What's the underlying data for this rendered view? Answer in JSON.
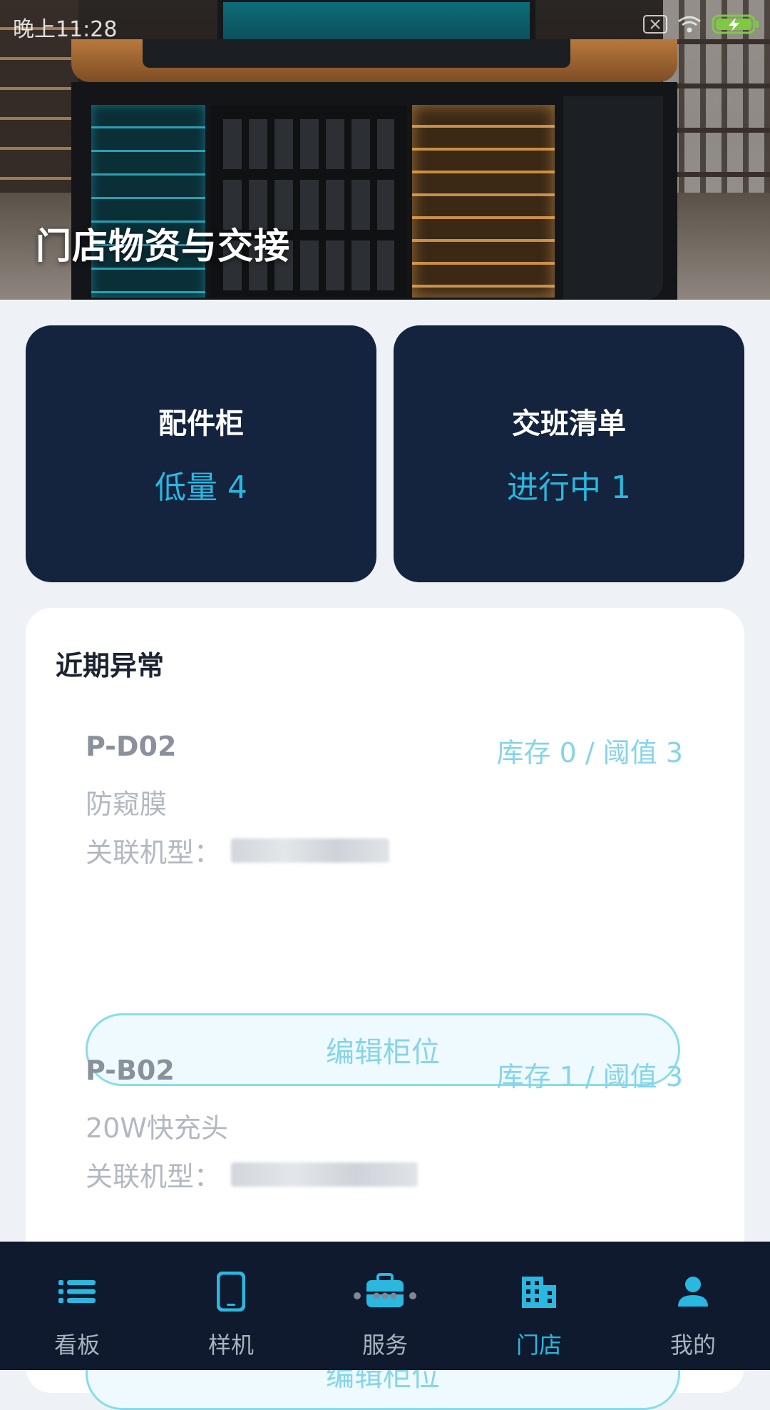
{
  "status_bar": {
    "time": "晚上11:28"
  },
  "hero": {
    "title": "门店物资与交接"
  },
  "summary_cards": [
    {
      "label": "配件柜",
      "value": "低量 4"
    },
    {
      "label": "交班清单",
      "value": "进行中 1"
    }
  ],
  "alerts": {
    "title": "近期异常",
    "items": [
      {
        "code": "P-D02",
        "stock": "库存 0 / 阈值 3",
        "name": "防窥膜",
        "model_label": "关联机型：",
        "button": "编辑柜位"
      },
      {
        "code": "P-B02",
        "stock": "库存 1 / 阈值 3",
        "name": "20W快充头",
        "model_label": "关联机型：",
        "button": "编辑柜位"
      }
    ]
  },
  "nav": {
    "items": [
      {
        "label": "看板",
        "icon": "list-icon"
      },
      {
        "label": "样机",
        "icon": "phone-icon"
      },
      {
        "label": "服务",
        "icon": "toolbox-icon"
      },
      {
        "label": "门店",
        "icon": "building-icon"
      },
      {
        "label": "我的",
        "icon": "person-icon"
      }
    ],
    "active": "门店"
  },
  "colors": {
    "accent": "#29b8e0",
    "card_bg": "#14233e",
    "nav_bg": "#0f1a2e",
    "page_bg": "#eef2f7"
  }
}
